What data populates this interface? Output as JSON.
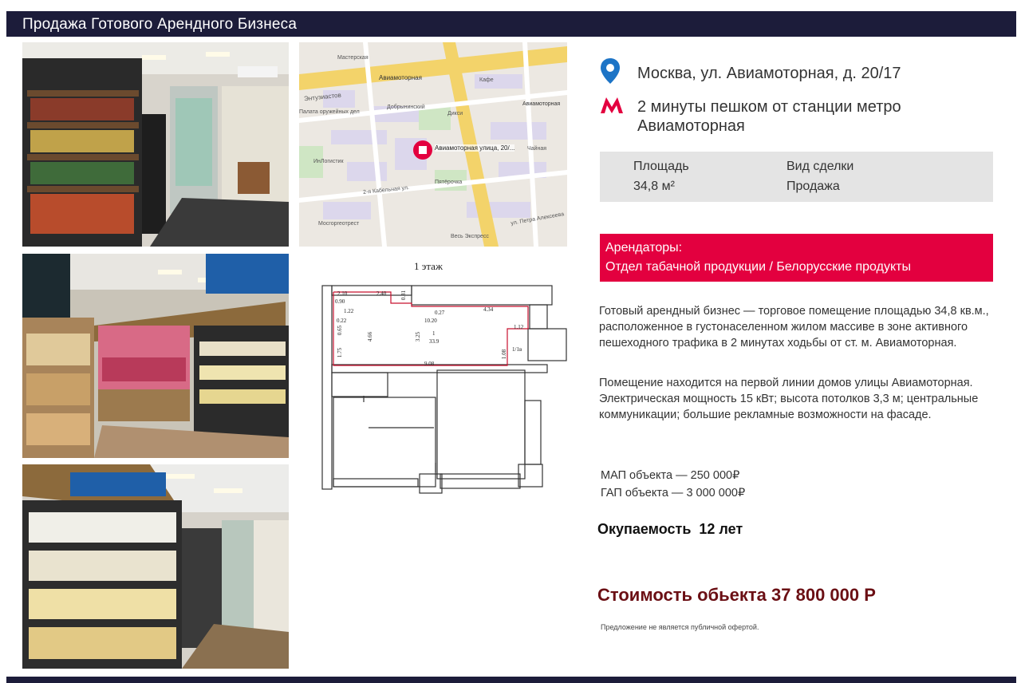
{
  "header": {
    "title": "Продажа Готового Арендного Бизнеса"
  },
  "location": {
    "address": "Москва, ул. Авиамоторная, д. 20/17",
    "metro_line1": "2 минуты пешком от станции метро",
    "metro_line2": "Авиамоторная"
  },
  "specs": {
    "area_label": "Площадь",
    "area_value": "34,8 м²",
    "deal_label": "Вид сделки",
    "deal_value": "Продажа"
  },
  "tenants": {
    "label": "Арендаторы:",
    "value": "Отдел табачной продукции / Белорусские продукты"
  },
  "description": {
    "p1": "Готовый арендный бизнес — торговое помещение площадью 34,8 кв.м., расположенное в густонаселенном жилом массиве в зоне активного пешеходного трафика в 2 минутах ходьбы от ст. м. Авиамоторная.",
    "p2": "Помещение находится на первой линии домов улицы Авиамоторная. Электрическая мощность 15 кВт; высота потолков 3,3 м; центральные коммуникации; большие рекламные возможности на фасаде."
  },
  "prices": {
    "map": "МАП объекта — 250 000₽",
    "gap": "ГАП объекта — 3 000 000₽"
  },
  "payback": "Окупаемость  12 лет",
  "cost": "Стоимость обьекта 37 800 000 Р",
  "disclaimer": "Предложение не является публичной офертой.",
  "map": {
    "pin_label": "Авиамоторная улица, 20/...",
    "streets": [
      "Энтузиастов",
      "2-я Кабельная ул.",
      "ул. Петра Алексеева"
    ],
    "places": [
      "Мастерская",
      "Авиамоторная",
      "Добрынинский",
      "Пятёрочка",
      "Мосгоргеотрест",
      "Дикси",
      "Весь Экспресс",
      "Авиамоторная",
      "Палата оружейных дел",
      "ИнЛогистик",
      "Кафе",
      "Чайная"
    ]
  },
  "floor_plan": {
    "title": "1 этаж",
    "dims": [
      "2.10",
      "2.40",
      "0.81",
      "0.90",
      "1.22",
      "0.27",
      "4.34",
      "0.22",
      "0.65",
      "4.66",
      "10.20",
      "3.25",
      "33.9",
      "1.75",
      "1.12",
      "1.08",
      "1/1в",
      "9.08",
      "1"
    ]
  },
  "colors": {
    "header": "#1c1c3a",
    "accent": "#e3003f",
    "cost": "#6b0f14",
    "pin": "#1d74c6"
  },
  "icons": [
    "location-pin-icon",
    "metro-m-icon"
  ]
}
